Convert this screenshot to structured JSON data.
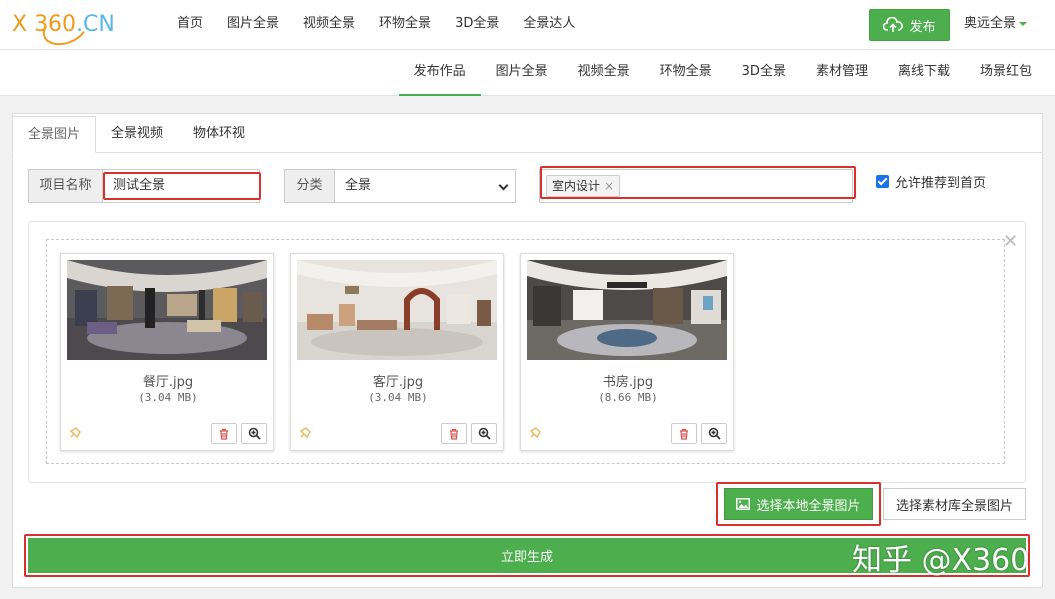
{
  "header": {
    "logo_text": "X 360",
    "logo_suffix": ".CN",
    "nav": [
      "首页",
      "图片全景",
      "视频全景",
      "环物全景",
      "3D全景",
      "全景达人"
    ],
    "publish_label": "发布",
    "user_name": "奥远全景"
  },
  "subnav": [
    "发布作品",
    "图片全景",
    "视频全景",
    "环物全景",
    "3D全景",
    "素材管理",
    "离线下载",
    "场景红包"
  ],
  "tabs": [
    "全景图片",
    "全景视频",
    "物体环视"
  ],
  "form": {
    "project_label": "项目名称",
    "project_value": "测试全景",
    "category_label": "分类",
    "category_value": "全景",
    "tag_value": "室内设计",
    "tag_remove": "×",
    "recommend_label": "允许推荐到首页"
  },
  "images": [
    {
      "name": "餐厅.jpg",
      "size": "(3.04 MB)"
    },
    {
      "name": "客厅.jpg",
      "size": "(3.04 MB)"
    },
    {
      "name": "书房.jpg",
      "size": "(8.66 MB)"
    }
  ],
  "buttons": {
    "select_local": "选择本地全景图片",
    "select_library": "选择素材库全景图片",
    "generate": "立即生成"
  },
  "watermark": "知乎 @X360",
  "colors": {
    "accent": "#4cae4c",
    "highlight": "#d9302c",
    "logo": "#f39a1e"
  }
}
